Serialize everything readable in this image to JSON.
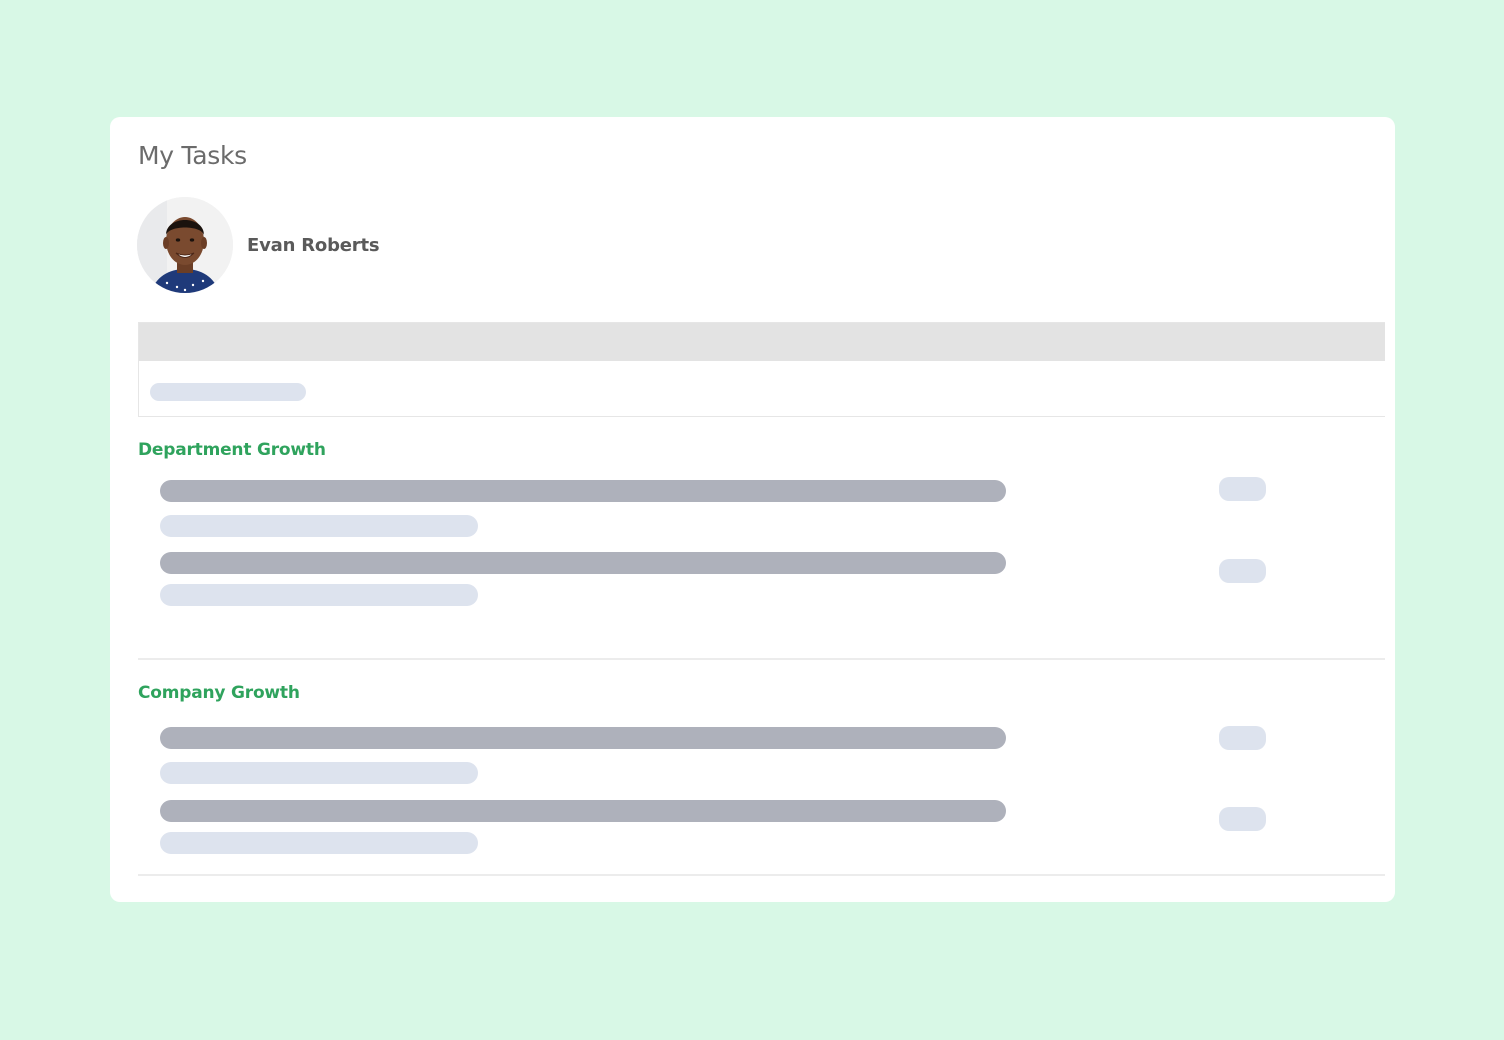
{
  "page": {
    "title": "My Tasks"
  },
  "user": {
    "name": "Evan Roberts",
    "avatar_icon": "user-avatar-photo"
  },
  "sections": [
    {
      "title": "Department Growth",
      "task_count": 2
    },
    {
      "title": "Company Growth",
      "task_count": 2
    }
  ],
  "colors": {
    "background": "#d8f8e6",
    "section_title": "#2fa35d",
    "placeholder_dark": "#aeb1bb",
    "placeholder_light": "#dde3ee"
  }
}
